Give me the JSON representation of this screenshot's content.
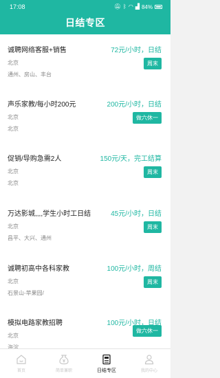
{
  "status_bar": {
    "time": "17:08",
    "battery": "84%"
  },
  "header": {
    "title": "日结专区"
  },
  "jobs": [
    {
      "title": "诚聘网络客服+销售",
      "salary": "72元/小时，日结",
      "city": "北京",
      "district": "通州、房山、丰台",
      "tag": "周末"
    },
    {
      "title": "声乐家教/每小时200元",
      "salary": "200元/小时，日结",
      "city": "北京",
      "district": "",
      "tag": "做六休一"
    },
    {
      "title": "促销/导购急需2人",
      "salary": "150元/天，完工结算",
      "city": "北京",
      "district": "北京",
      "tag": "周末"
    },
    {
      "title": "万达影城,,,,学生小时工日结",
      "salary": "45元/小时，日结",
      "city": "北京",
      "district": "昌平、大兴、通州",
      "tag": "周末"
    },
    {
      "title": "诚聘初高中各科家教",
      "salary": "100元/小时，周结",
      "city": "北京",
      "district": "石景山-苹果园/",
      "tag": "周末"
    },
    {
      "title": "模拟电路家教招聘",
      "salary": "100元/小时，日结",
      "city": "北京",
      "district": "海淀",
      "tag": "做六休一"
    }
  ],
  "tabs": [
    {
      "label": "首页",
      "icon": "home-icon"
    },
    {
      "label": "简单兼职",
      "icon": "money-bag-icon"
    },
    {
      "label": "日结专区",
      "icon": "document-icon"
    },
    {
      "label": "我的中心",
      "icon": "user-icon"
    }
  ]
}
